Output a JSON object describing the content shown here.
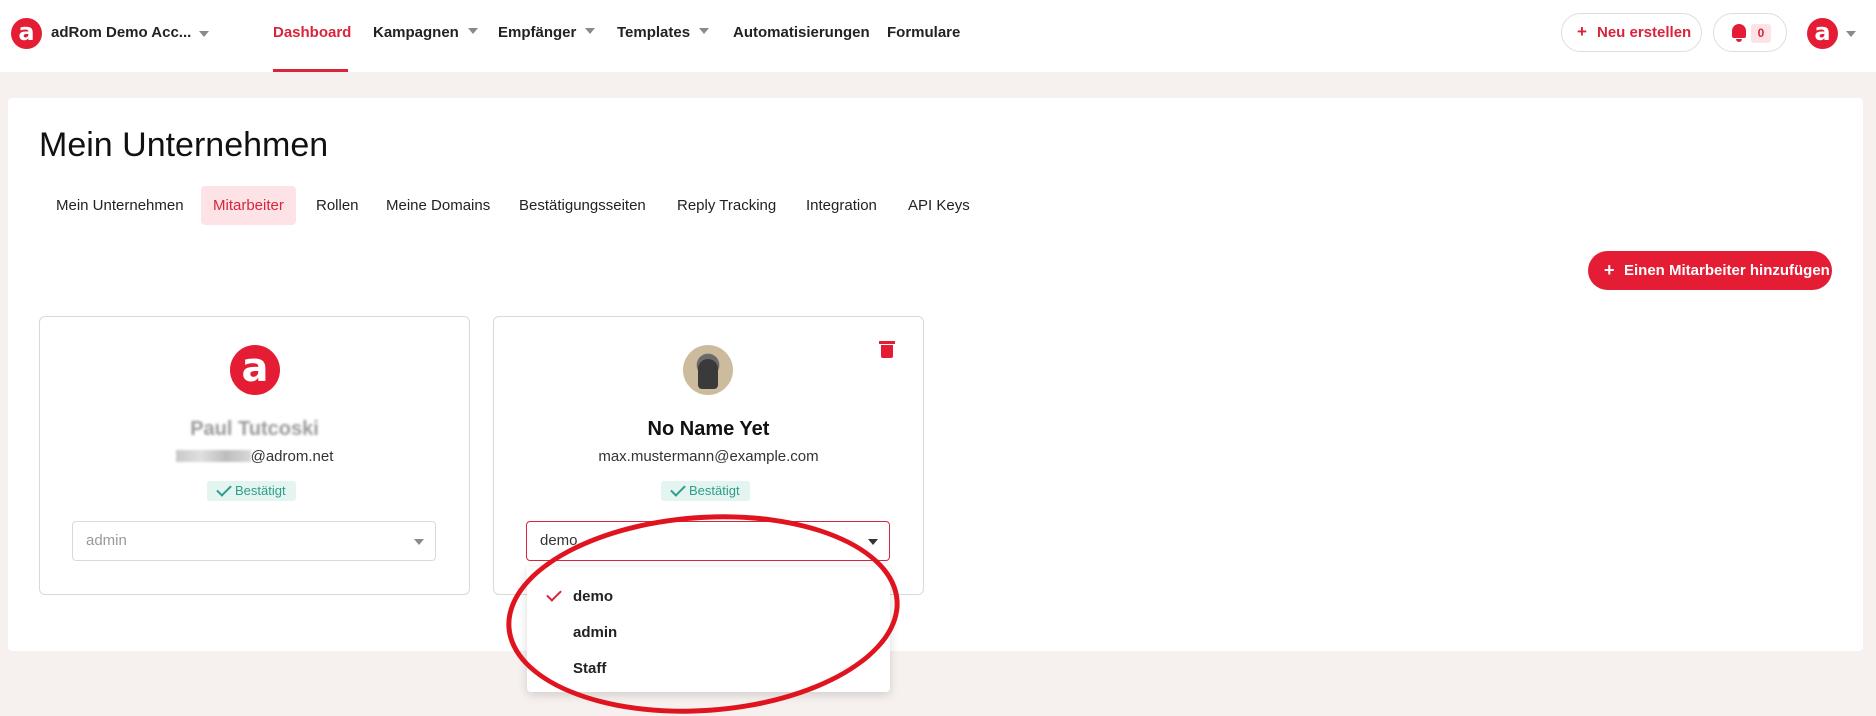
{
  "topbar": {
    "account_name": "adRom Demo Acc...",
    "brand_glyph": "a",
    "nav": [
      {
        "label": "Dashboard",
        "active": true
      },
      {
        "label": "Kampagnen"
      },
      {
        "label": "Empfänger"
      },
      {
        "label": "Templates"
      },
      {
        "label": "Automatisierungen"
      },
      {
        "label": "Formulare"
      }
    ],
    "new_button": "Neu erstellen",
    "plus_glyph": "+",
    "notification_count": "0"
  },
  "page": {
    "title": "Mein Unternehmen",
    "tabs": [
      {
        "label": "Mein Unternehmen"
      },
      {
        "label": "Mitarbeiter",
        "active": true
      },
      {
        "label": "Rollen"
      },
      {
        "label": "Meine Domains"
      },
      {
        "label": "Bestätigungsseiten"
      },
      {
        "label": "Reply Tracking"
      },
      {
        "label": "Integration"
      },
      {
        "label": "API Keys"
      }
    ],
    "add_button": "Einen Mitarbeiter hinzufügen"
  },
  "members": [
    {
      "name": "Paul Tutcoski",
      "email_domain": "@adrom.net",
      "status": "Bestätigt",
      "role": "admin",
      "avatar_glyph": "a"
    },
    {
      "name": "No Name Yet",
      "email": "max.mustermann@example.com",
      "status": "Bestätigt",
      "role": "demo"
    }
  ],
  "role_dropdown": {
    "options": [
      "demo",
      "admin",
      "Staff"
    ],
    "selected": "demo"
  },
  "colors": {
    "brand": "#e41d35",
    "accent_text": "#d8253b",
    "status_green": "#2e9d8a",
    "highlight": "#e0141f"
  },
  "icons": [
    "brand-logo-icon",
    "chevron-down-icon",
    "plus-icon",
    "bell-icon",
    "trash-icon",
    "check-icon"
  ]
}
